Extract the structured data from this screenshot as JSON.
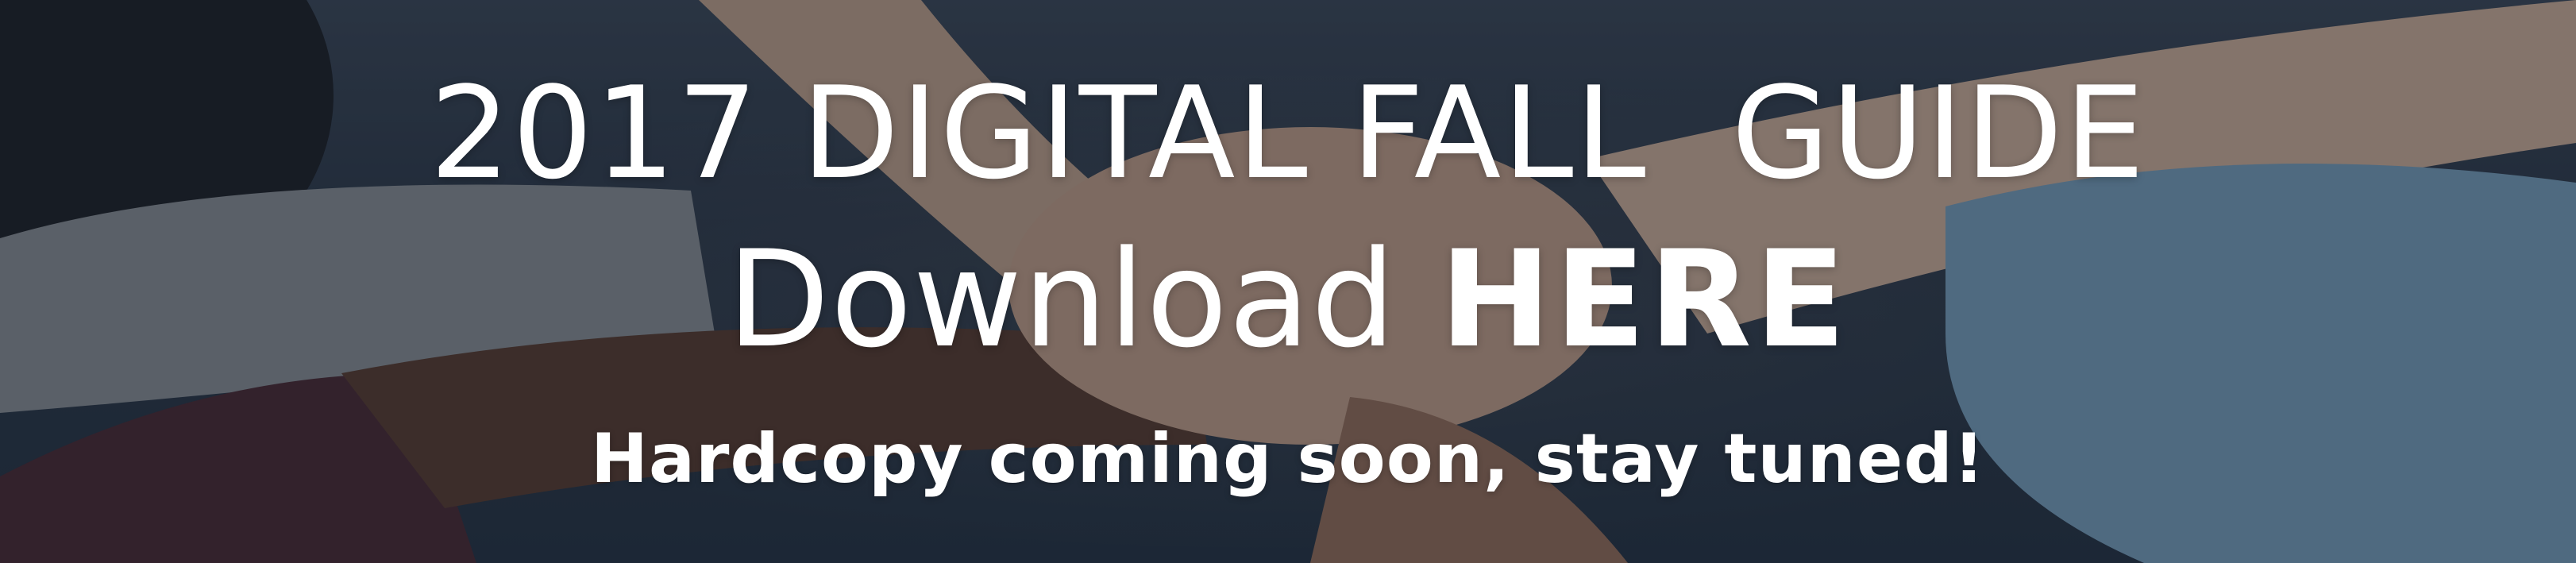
{
  "banner": {
    "title": "2017 DIGITAL FALL  GUIDE",
    "download_text": "Download",
    "download_link": "HERE",
    "tagline": "Hardcopy coming soon, stay tuned!"
  },
  "colors": {
    "text": "#ffffff",
    "overlay": "#1e2a3a",
    "skin_light": "#d9b8a0",
    "skin_dark": "#5a3a2c",
    "denim": "#7fa6c4",
    "grey_sleeve": "#8c8f93",
    "maroon_sleeve": "#4a2630"
  }
}
